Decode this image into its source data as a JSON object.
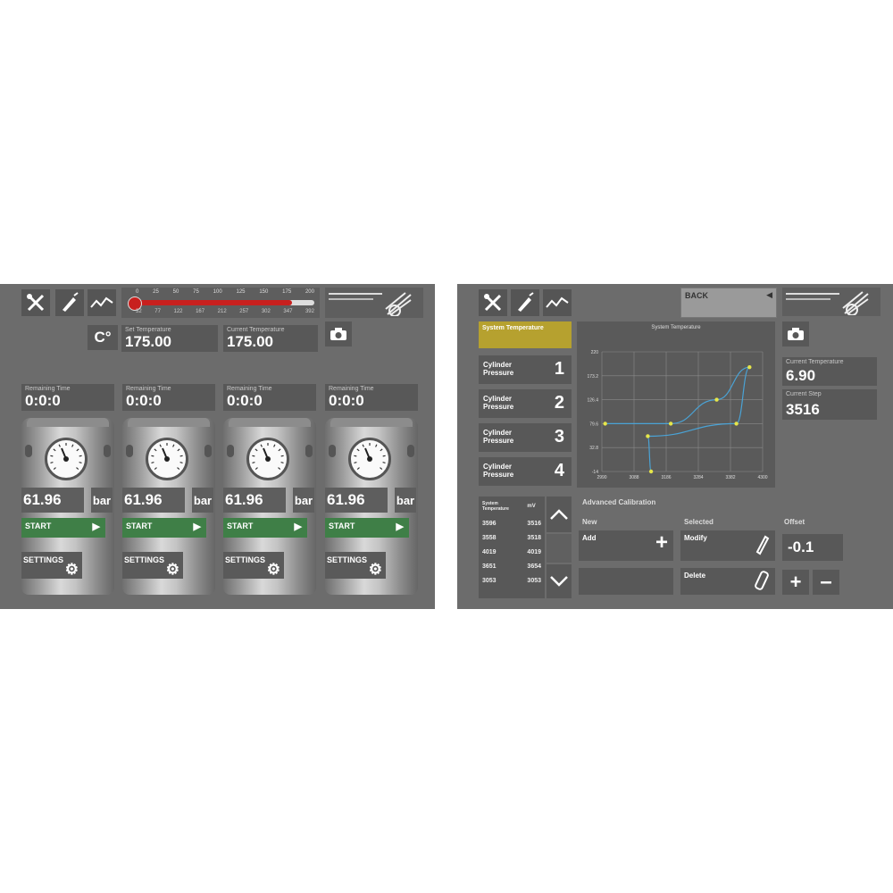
{
  "left_panel": {
    "toolbar": {
      "tools_icon": "tools-icon",
      "pen_icon": "pen-icon",
      "chart_icon": "chart-icon"
    },
    "thermometer": {
      "ticks": [
        "0",
        "25",
        "50",
        "75",
        "100",
        "125",
        "150",
        "175",
        "200"
      ],
      "sub_ticks": [
        "32",
        "77",
        "122",
        "167",
        "212",
        "257",
        "302",
        "347",
        "392"
      ],
      "level": 0.875,
      "color": "#c8201e"
    },
    "unit_label": "C°",
    "temps": [
      {
        "label": "Set Temperature",
        "value": "175.00"
      },
      {
        "label": "Current Temperature",
        "value": "175.00"
      }
    ],
    "stations": [
      {
        "time_label": "Remaining Time",
        "time": "0:0:0",
        "pressure": "61.96",
        "unit": "bar",
        "start": "START",
        "settings": "SETTINGS"
      },
      {
        "time_label": "Remaining Time",
        "time": "0:0:0",
        "pressure": "61.96",
        "unit": "bar",
        "start": "START",
        "settings": "SETTINGS"
      },
      {
        "time_label": "Remaining Time",
        "time": "0:0:0",
        "pressure": "61.96",
        "unit": "bar",
        "start": "START",
        "settings": "SETTINGS"
      },
      {
        "time_label": "Remaining Time",
        "time": "0:0:0",
        "pressure": "61.96",
        "unit": "bar",
        "start": "START",
        "settings": "SETTINGS"
      }
    ]
  },
  "right_panel": {
    "back_label": "BACK",
    "system_temp_button": "System Temperature",
    "cylinders": [
      {
        "label": "Cylinder Pressure",
        "num": "1"
      },
      {
        "label": "Cylinder Pressure",
        "num": "2"
      },
      {
        "label": "Cylinder Pressure",
        "num": "3"
      },
      {
        "label": "Cylinder Pressure",
        "num": "4"
      }
    ],
    "readouts": [
      {
        "label": "Current Temperature",
        "value": "6.90"
      },
      {
        "label": "Current Step",
        "value": "3516"
      }
    ],
    "chart_title": "System Temperature",
    "table": {
      "headers": [
        "System Temperature",
        "mV"
      ],
      "rows": [
        [
          "3596",
          "3516"
        ],
        [
          "3558",
          "3518"
        ],
        [
          "4019",
          "4019"
        ],
        [
          "3651",
          "3654"
        ],
        [
          "3053",
          "3053"
        ]
      ]
    },
    "calibration": {
      "title": "Advanced Calibration",
      "new_label": "New",
      "selected_label": "Selected",
      "offset_label": "Offset",
      "add": "Add",
      "modify": "Modify",
      "delete": "Delete",
      "offset_value": "-0.1"
    }
  },
  "chart_data": {
    "type": "line",
    "title": "System Temperature",
    "x_ticks": [
      "2990",
      "3088",
      "3186",
      "3284",
      "3382",
      "4300"
    ],
    "y_ticks": [
      "220",
      "173.2",
      "126.4",
      "79.6",
      "32.8",
      "-14"
    ],
    "points": [
      [
        3000,
        79.6
      ],
      [
        3200,
        79.6
      ],
      [
        3340,
        126.4
      ],
      [
        3440,
        190
      ],
      [
        3400,
        79.6
      ],
      [
        3130,
        55
      ],
      [
        3140,
        -14
      ]
    ]
  }
}
